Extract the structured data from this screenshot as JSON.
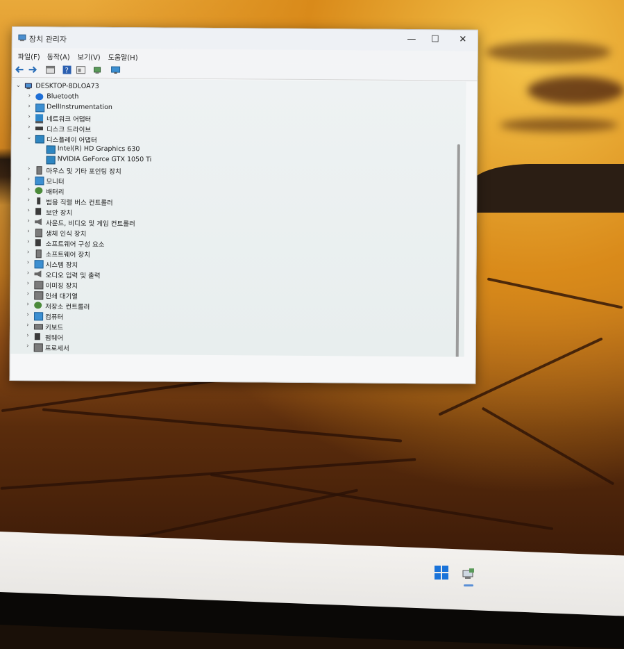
{
  "window": {
    "title": "장치 관리자",
    "controls": {
      "minimize": "—",
      "maximize": "☐",
      "close": "✕"
    }
  },
  "menubar": {
    "items": [
      "파일(F)",
      "동작(A)",
      "보기(V)",
      "도움말(H)"
    ]
  },
  "toolbar": {
    "buttons": [
      "back-icon",
      "forward-icon",
      "properties-icon",
      "help-icon",
      "view-icon",
      "update-driver-icon",
      "monitor-icon"
    ]
  },
  "tree": {
    "root": "DESKTOP-8DLOA73",
    "nodes": [
      {
        "label": "Bluetooth",
        "icon": "bluetooth-icon",
        "expanded": false
      },
      {
        "label": "DellInstrumentation",
        "icon": "dell-icon",
        "expanded": false
      },
      {
        "label": "네트워크 어댑터",
        "icon": "network-adapter-icon",
        "expanded": false
      },
      {
        "label": "디스크 드라이브",
        "icon": "disk-drive-icon",
        "expanded": false
      },
      {
        "label": "디스플레이 어댑터",
        "icon": "display-adapter-icon",
        "expanded": true,
        "children": [
          {
            "label": "Intel(R) HD Graphics 630",
            "icon": "display-adapter-icon"
          },
          {
            "label": "NVIDIA GeForce GTX 1050 Ti",
            "icon": "display-adapter-icon"
          }
        ]
      },
      {
        "label": "마우스 및 기타 포인팅 장치",
        "icon": "mouse-icon",
        "expanded": false
      },
      {
        "label": "모니터",
        "icon": "monitor-icon",
        "expanded": false
      },
      {
        "label": "배터리",
        "icon": "battery-icon",
        "expanded": false
      },
      {
        "label": "범용 직렬 버스 컨트롤러",
        "icon": "usb-icon",
        "expanded": false
      },
      {
        "label": "보안 장치",
        "icon": "security-device-icon",
        "expanded": false
      },
      {
        "label": "사운드, 비디오 및 게임 컨트롤러",
        "icon": "speaker-icon",
        "expanded": false
      },
      {
        "label": "생체 인식 장치",
        "icon": "biometric-icon",
        "expanded": false
      },
      {
        "label": "소프트웨어 구성 요소",
        "icon": "software-component-icon",
        "expanded": false
      },
      {
        "label": "소프트웨어 장치",
        "icon": "software-device-icon",
        "expanded": false
      },
      {
        "label": "시스템 장치",
        "icon": "system-device-icon",
        "expanded": false
      },
      {
        "label": "오디오 입력 및 출력",
        "icon": "audio-icon",
        "expanded": false
      },
      {
        "label": "이미징 장치",
        "icon": "camera-icon",
        "expanded": false
      },
      {
        "label": "인쇄 대기열",
        "icon": "printer-icon",
        "expanded": false
      },
      {
        "label": "저장소 컨트롤러",
        "icon": "storage-controller-icon",
        "expanded": false
      },
      {
        "label": "컴퓨터",
        "icon": "computer-icon",
        "expanded": false
      },
      {
        "label": "키보드",
        "icon": "keyboard-icon",
        "expanded": false
      },
      {
        "label": "펌웨어",
        "icon": "firmware-icon",
        "expanded": false
      },
      {
        "label": "프로세서",
        "icon": "processor-icon",
        "expanded": false
      }
    ]
  },
  "taskbar": {
    "items": [
      "windows-start-icon",
      "device-manager-icon"
    ]
  },
  "colors": {
    "window_bg": "#f6f7f8",
    "tree_bg": "#eef2f3",
    "accent": "#1a73d9",
    "taskbar_bg": "#f3f1ee"
  }
}
